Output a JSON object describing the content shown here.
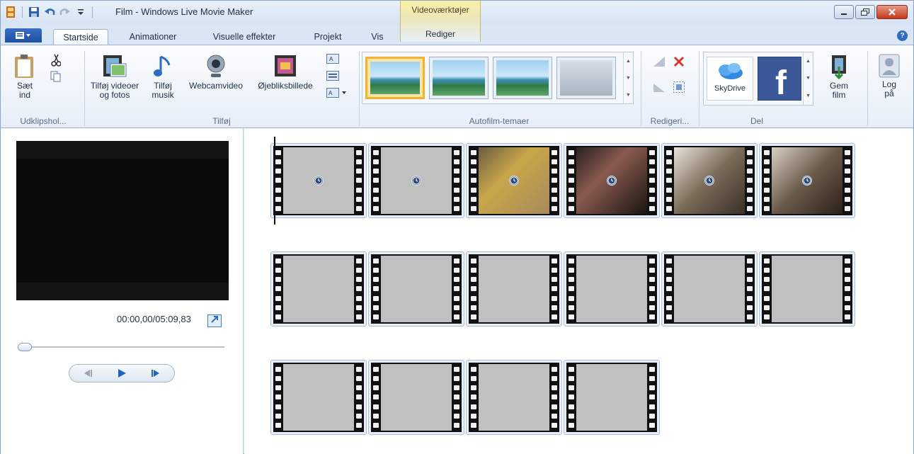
{
  "window": {
    "title": "Film - Windows Live Movie Maker",
    "context_tab": {
      "group": "Videoværktøjer",
      "tab": "Rediger"
    }
  },
  "tabs": [
    "Startside",
    "Animationer",
    "Visuelle effekter",
    "Projekt",
    "Vis"
  ],
  "active_tab": "Startside",
  "ribbon": {
    "clipboard": {
      "paste": "Sæt ind",
      "label": "Udklipshol..."
    },
    "add": {
      "add_videos": "Tilføj videoer og fotos",
      "add_music": "Tilføj musik",
      "webcam": "Webcamvideo",
      "snapshot": "Øjebliksbillede",
      "label": "Tilføj"
    },
    "automovie": {
      "label": "Autofilm-temaer"
    },
    "editing": {
      "label": "Redigeri..."
    },
    "share": {
      "skydrive": "SkyDrive",
      "label": "Del"
    },
    "save_movie": "Gem film",
    "sign_in": "Log på"
  },
  "preview": {
    "time": "00:00,00/05:09,83",
    "seek_fraction": 0.0
  },
  "clips": [
    {
      "type": "blank",
      "clock": true
    },
    {
      "type": "blank",
      "clock": true
    },
    {
      "type": "photo",
      "clock": true
    },
    {
      "type": "photo",
      "clock": true
    },
    {
      "type": "photo",
      "clock": true
    },
    {
      "type": "photo",
      "clock": true
    },
    {
      "type": "blank",
      "clock": false
    },
    {
      "type": "blank",
      "clock": false
    },
    {
      "type": "blank",
      "clock": false
    },
    {
      "type": "blank",
      "clock": false
    },
    {
      "type": "blank",
      "clock": false
    },
    {
      "type": "blank",
      "clock": false
    },
    {
      "type": "blank",
      "clock": false
    },
    {
      "type": "blank",
      "clock": false
    },
    {
      "type": "blank",
      "clock": false
    },
    {
      "type": "blank",
      "clock": false
    }
  ],
  "colors": {
    "accent": "#2f6cc4",
    "selected_theme": "#f2b330",
    "close": "#c2391d"
  }
}
